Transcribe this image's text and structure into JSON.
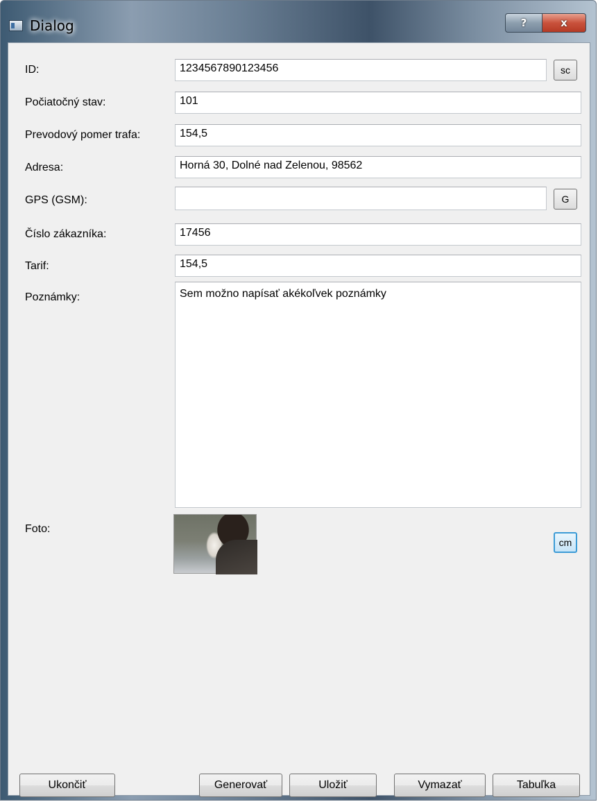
{
  "window": {
    "title": "Dialog",
    "help_glyph": "?",
    "close_glyph": "x"
  },
  "form": {
    "id_label": "ID:",
    "id_value": "1234567890123456",
    "sc_button": "sc",
    "start_label": "Počiatočný stav:",
    "start_value": "101",
    "ratio_label": "Prevodový pomer trafa:",
    "ratio_value": "154,5",
    "address_label": "Adresa:",
    "address_value": "Horná 30, Dolné nad Zelenou, 98562",
    "gps_label": "GPS (GSM):",
    "gps_value": "",
    "g_button": "G",
    "customer_label": "Číslo zákazníka:",
    "customer_value": "17456",
    "tariff_label": "Tarif:",
    "tariff_value": "154,5",
    "notes_label": "Poznámky:",
    "notes_value": "Sem možno napísať akékoľvek poznámky",
    "photo_label": "Foto:",
    "cm_button": "cm"
  },
  "buttons": {
    "quit": "Ukončiť",
    "generate": "Generovať",
    "save": "Uložiť",
    "delete": "Vymazať",
    "table": "Tabuľka"
  }
}
